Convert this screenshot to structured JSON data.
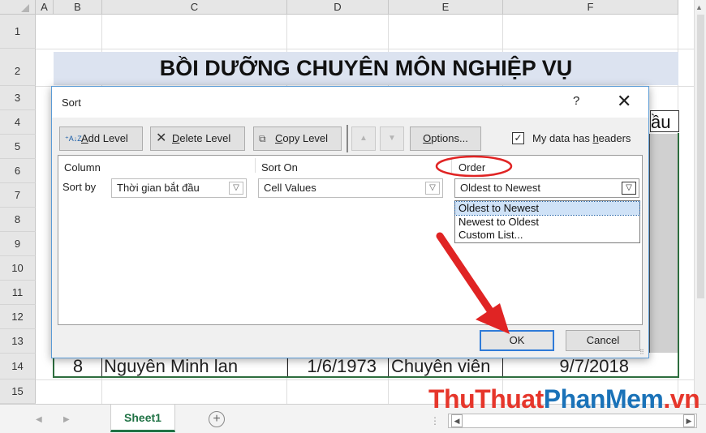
{
  "spreadsheet": {
    "columns": [
      "A",
      "B",
      "C",
      "D",
      "E",
      "F"
    ],
    "rows": [
      "1",
      "2",
      "3",
      "4",
      "5",
      "6",
      "7",
      "8",
      "9",
      "10",
      "11",
      "12",
      "13",
      "14",
      "15"
    ],
    "title": "BỒI DƯỠNG CHUYÊN MÔN NGHIỆP VỤ",
    "header_snippet": "ầu",
    "row14": {
      "stt": "8",
      "name": "Nguyễn Minh lan",
      "dob": "1/6/1973",
      "position": "Chuyên viên",
      "start_date": "9/7/2018"
    },
    "sheet_tab": "Sheet1",
    "add_sheet": "+"
  },
  "watermark": {
    "part1": "ThuThuat",
    "part2": "PhanMem",
    "part3": ".vn"
  },
  "dialog": {
    "title": "Sort",
    "help": "?",
    "close": "✕",
    "toolbar": {
      "add_level_prefix": "",
      "add_level_u": "A",
      "add_level_rest": "dd Level",
      "delete_level_u": "D",
      "delete_level_rest": "elete Level",
      "copy_level_u": "C",
      "copy_level_rest": "opy Level",
      "options_u": "O",
      "options_rest": "ptions...",
      "headers_pre": "My data has ",
      "headers_u": "h",
      "headers_rest": "eaders",
      "headers_checked": "✓"
    },
    "columns_header": {
      "column": "Column",
      "sort_on": "Sort On",
      "order": "Order"
    },
    "row": {
      "label": "Sort by",
      "column_value": "Thời gian bắt đầu",
      "sort_on_value": "Cell Values",
      "order_value": "Oldest to Newest"
    },
    "order_options": [
      "Oldest to Newest",
      "Newest to Oldest",
      "Custom List..."
    ],
    "ok": "OK",
    "cancel": "Cancel"
  },
  "colors": {
    "accent": "#2f7bd8",
    "excel_green": "#217346",
    "annotation_red": "#e02424"
  }
}
